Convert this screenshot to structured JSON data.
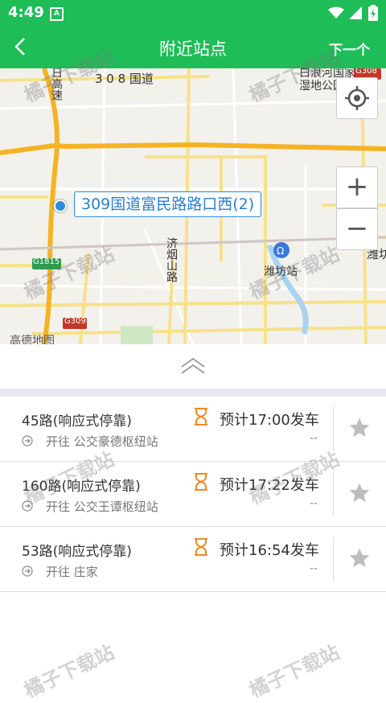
{
  "status_bar": {
    "time": "4:49",
    "notification_icon": "A"
  },
  "app_bar": {
    "title": "附近站点",
    "next_label": "下一个"
  },
  "map": {
    "labels": {
      "highway_left": "日高速",
      "road_308": "3 0 8 国道",
      "wetland_park": "白浪河国家湿地公园",
      "g308": "G308",
      "jiyan_road": "济烟山路",
      "weifang_station": "潍坊站",
      "g1815": "G1815",
      "g309": "G309",
      "weicheng": "潍坊",
      "map_brand": "高德地图"
    },
    "station_label": "309国道富民路路口西(2)"
  },
  "buses": [
    {
      "route": "45路(响应式停靠)",
      "destination": "开往 公交豪德枢纽站",
      "eta": "预计17:00发车",
      "extra": "--"
    },
    {
      "route": "160路(响应式停靠)",
      "destination": "开往 公交王谭枢纽站",
      "eta": "预计17:22发车",
      "extra": "--"
    },
    {
      "route": "53路(响应式停靠)",
      "destination": "开往 庄家",
      "eta": "预计16:54发车",
      "extra": "--"
    }
  ],
  "watermark": "橘子下载站",
  "colors": {
    "primary": "#1ebd57",
    "accent_orange": "#f08a24",
    "station_blue": "#2b8ddf"
  }
}
